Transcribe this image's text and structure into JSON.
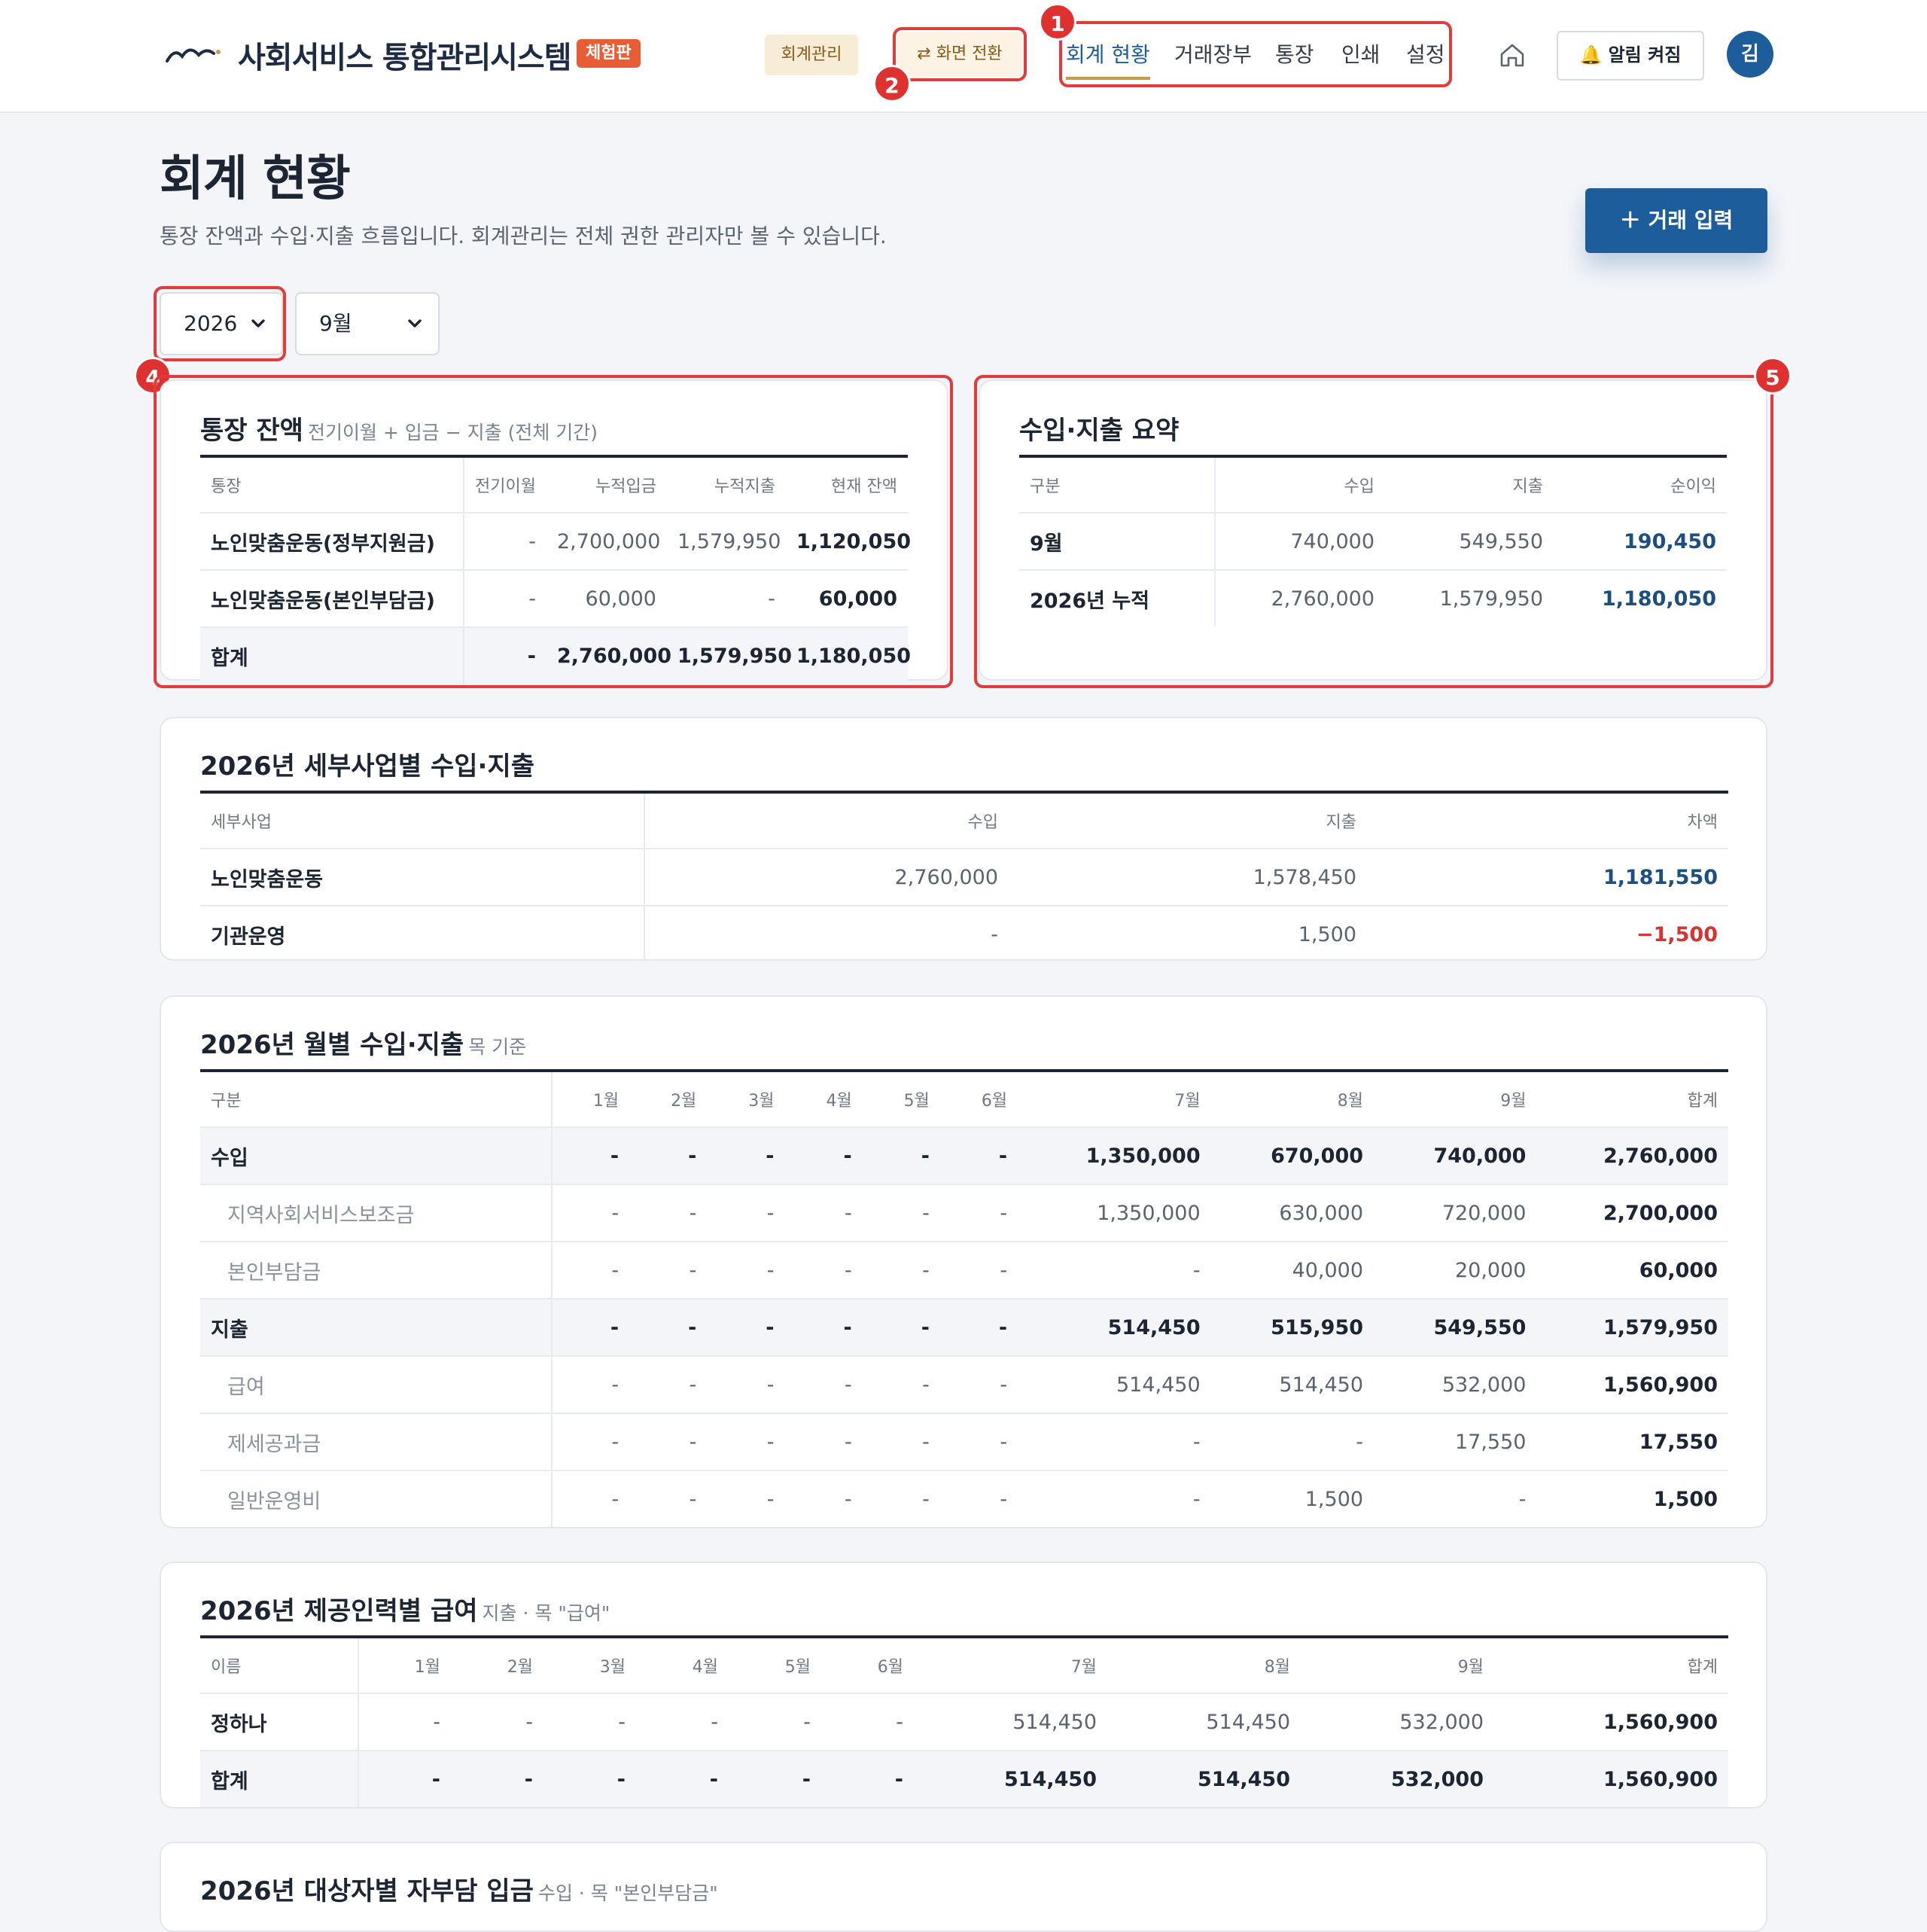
{
  "header": {
    "brand": "사회서비스 통합관리시스템",
    "brand_badge": "체험판",
    "module_chip": "회계관리",
    "switch_button": "⇄ 화면 전환",
    "nav": [
      "회계 현황",
      "거래장부",
      "통장",
      "인쇄",
      "설정"
    ],
    "alert_button": "알림 켜짐",
    "avatar": "김"
  },
  "markers": [
    "1",
    "2",
    "4",
    "5"
  ],
  "page": {
    "title": "회계 현황",
    "subtitle": "통장 잔액과 수입·지출 흐름입니다. 회계관리는 전체 권한 관리자만 볼 수 있습니다.",
    "add_button": "＋  거래 입력",
    "year": "2026",
    "month": "9월"
  },
  "balance": {
    "title": "통장 잔액",
    "subtitle": "전기이월 + 입금 − 지출 (전체 기간)",
    "headers": [
      "통장",
      "전기이월",
      "누적입금",
      "누적지출",
      "현재 잔액"
    ],
    "rows": [
      [
        "노인맞춤운동(정부지원금)",
        "-",
        "2,700,000",
        "1,579,950",
        "1,120,050"
      ],
      [
        "노인맞춤운동(본인부담금)",
        "-",
        "60,000",
        "-",
        "60,000"
      ]
    ],
    "total": [
      "합계",
      "-",
      "2,760,000",
      "1,579,950",
      "1,180,050"
    ]
  },
  "summary": {
    "title": "수입·지출 요약",
    "headers": [
      "구분",
      "수입",
      "지출",
      "순이익"
    ],
    "rows": [
      [
        "9월",
        "740,000",
        "549,550",
        "190,450"
      ],
      [
        "2026년 누적",
        "2,760,000",
        "1,579,950",
        "1,180,050"
      ]
    ]
  },
  "business": {
    "title": "2026년 세부사업별 수입·지출",
    "headers": [
      "세부사업",
      "수입",
      "지출",
      "차액"
    ],
    "rows": [
      [
        "노인맞춤운동",
        "2,760,000",
        "1,578,450",
        "1,181,550"
      ],
      [
        "기관운영",
        "-",
        "1,500",
        "−1,500"
      ]
    ]
  },
  "monthly": {
    "title": "2026년 월별 수입·지출",
    "subtitle": "목 기준",
    "headers": [
      "구분",
      "1월",
      "2월",
      "3월",
      "4월",
      "5월",
      "6월",
      "7월",
      "8월",
      "9월",
      "합계"
    ],
    "rows": [
      [
        "수입",
        "-",
        "-",
        "-",
        "-",
        "-",
        "-",
        "1,350,000",
        "670,000",
        "740,000",
        "2,760,000"
      ],
      [
        "지역사회서비스보조금",
        "-",
        "-",
        "-",
        "-",
        "-",
        "-",
        "1,350,000",
        "630,000",
        "720,000",
        "2,700,000"
      ],
      [
        "본인부담금",
        "-",
        "-",
        "-",
        "-",
        "-",
        "-",
        "-",
        "40,000",
        "20,000",
        "60,000"
      ],
      [
        "지출",
        "-",
        "-",
        "-",
        "-",
        "-",
        "-",
        "514,450",
        "515,950",
        "549,550",
        "1,579,950"
      ],
      [
        "급여",
        "-",
        "-",
        "-",
        "-",
        "-",
        "-",
        "514,450",
        "514,450",
        "532,000",
        "1,560,900"
      ],
      [
        "제세공과금",
        "-",
        "-",
        "-",
        "-",
        "-",
        "-",
        "-",
        "-",
        "17,550",
        "17,550"
      ],
      [
        "일반운영비",
        "-",
        "-",
        "-",
        "-",
        "-",
        "-",
        "-",
        "1,500",
        "-",
        "1,500"
      ]
    ]
  },
  "salary": {
    "title": "2026년 제공인력별 급여",
    "subtitle": "지출 · 목 \"급여\"",
    "headers": [
      "이름",
      "1월",
      "2월",
      "3월",
      "4월",
      "5월",
      "6월",
      "7월",
      "8월",
      "9월",
      "합계"
    ],
    "rows": [
      [
        "정하나",
        "-",
        "-",
        "-",
        "-",
        "-",
        "-",
        "514,450",
        "514,450",
        "532,000",
        "1,560,900"
      ]
    ],
    "total": [
      "합계",
      "-",
      "-",
      "-",
      "-",
      "-",
      "-",
      "514,450",
      "514,450",
      "532,000",
      "1,560,900"
    ]
  },
  "next_section": {
    "title": "2026년 대상자별 자부담 입금",
    "subtitle": "수입 · 목 \"본인부담금\""
  },
  "colors": {
    "primary": "#1e5d9c",
    "accent_badge": "#e85c36",
    "highlight": "#e23b3b",
    "negative": "#d63333",
    "positive": "#1b4f82"
  }
}
